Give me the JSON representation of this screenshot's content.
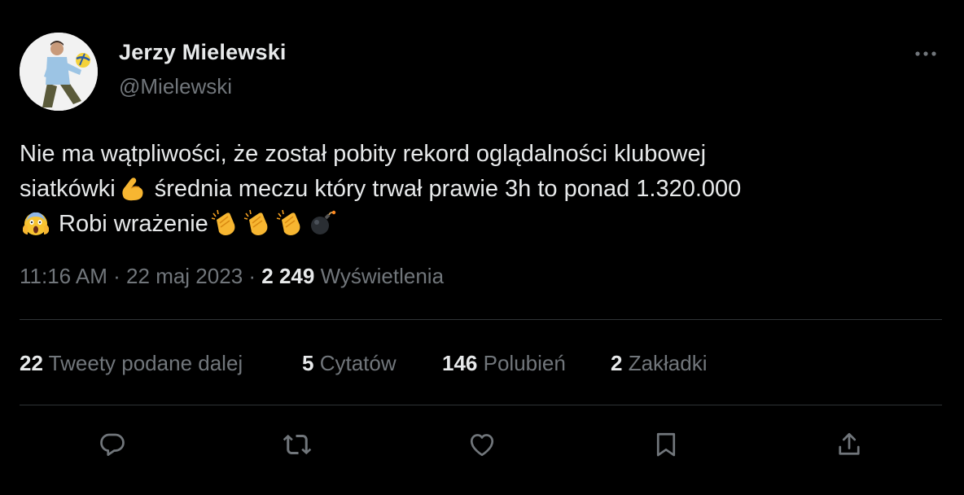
{
  "tweet": {
    "author_name": "Jerzy Mielewski",
    "author_handle": "@Mielewski",
    "text_line1": "Nie ma wątpliwości, że został pobity rekord oglądalności klubowej",
    "text_line2_a": "siatkówki",
    "text_line2_b": " średnia meczu który trwał prawie 3h to ponad 1.320.000",
    "text_line3": " Robi wrażenie",
    "emojis": [
      "flexed-biceps-icon",
      "screaming-face-icon",
      "clapping-hands-icon",
      "clapping-hands-icon",
      "clapping-hands-icon",
      "bomb-icon"
    ],
    "time": "11:16 AM",
    "separator": " · ",
    "date": "22 maj 2023",
    "views_count": "2 249",
    "views_label": " Wyświetlenia"
  },
  "stats": {
    "retweets": {
      "count": "22",
      "label": " Tweety podane dalej"
    },
    "quotes": {
      "count": "5",
      "label": " Cytatów"
    },
    "likes": {
      "count": "146",
      "label": " Polubień"
    },
    "bookmarks": {
      "count": "2",
      "label": " Zakładki"
    }
  },
  "actions": [
    "reply-icon",
    "retweet-icon",
    "like-icon",
    "bookmark-icon",
    "share-icon"
  ],
  "colors": {
    "background": "#000000",
    "text": "#e7e9ea",
    "secondary": "#71767b",
    "divider": "#2f3336"
  }
}
